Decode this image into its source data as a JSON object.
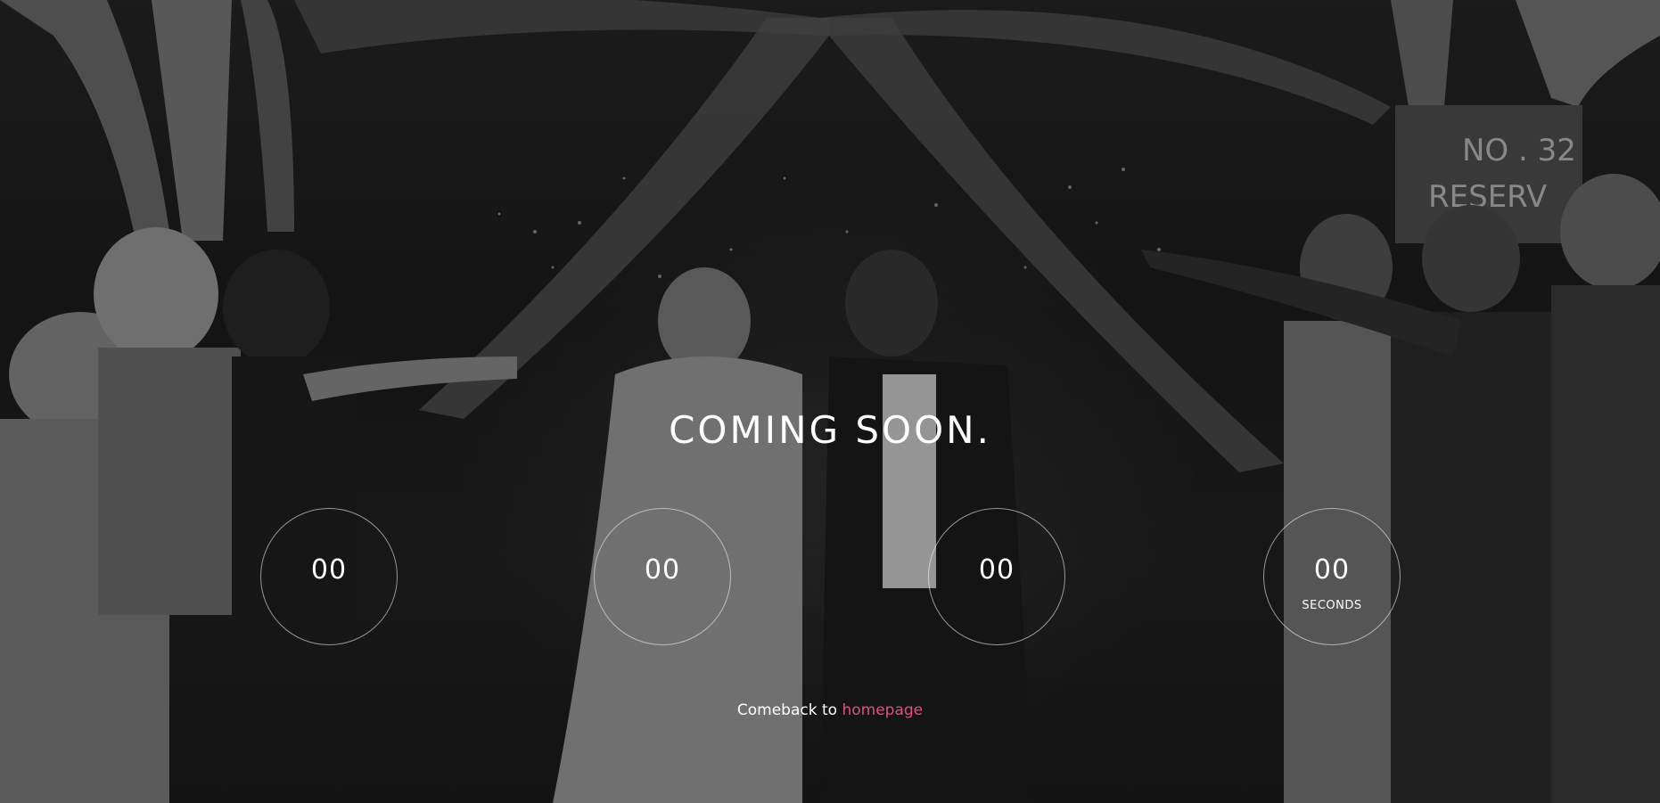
{
  "page": {
    "title": "COMING SOON.",
    "accent_color": "#e0527a"
  },
  "countdown": {
    "days": {
      "value": "00",
      "unit": ""
    },
    "hours": {
      "value": "00",
      "unit": ""
    },
    "minutes": {
      "value": "00",
      "unit": ""
    },
    "seconds": {
      "value": "00",
      "unit": "SECONDS"
    }
  },
  "footer": {
    "prefix": "Comeback to",
    "link_label": "homepage"
  },
  "background": {
    "sign_text_line1": "NO . 32",
    "sign_text_line2": "RESERV"
  }
}
